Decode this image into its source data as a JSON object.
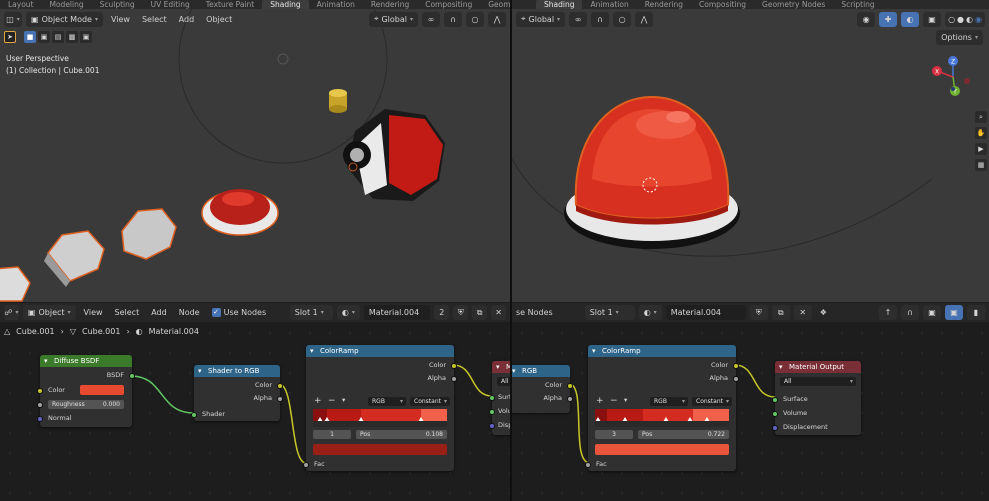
{
  "colors": {
    "accent": "#4772b3",
    "selection_outline": "#e06020",
    "diffuse_color": "#e84a30",
    "ramp_dark": "#8a1010",
    "ramp_red": "#d42c20",
    "ramp_light": "#f0604a",
    "left_ramp_output": "#9a1f17",
    "right_ramp_output": "#e8553b"
  },
  "left": {
    "tabs": [
      "Layout",
      "Modeling",
      "Sculpting",
      "UV Editing",
      "Texture Paint",
      "Shading",
      "Animation",
      "Rendering",
      "Compositing",
      "Geometry Nod"
    ],
    "active_tab": "Shading",
    "viewport": {
      "mode": "Object Mode",
      "menus": [
        "View",
        "Select",
        "Add",
        "Object"
      ],
      "transform_orientation": "Global",
      "perspective_label": "User Perspective",
      "collection_label": "(1) Collection | Cube.001"
    },
    "node_editor": {
      "type": "Object",
      "menus": [
        "View",
        "Select",
        "Add",
        "Node"
      ],
      "use_nodes_label": "Use Nodes",
      "slot": "Slot 1",
      "material": "Material.004",
      "user_count": "2",
      "breadcrumb": [
        "Cube.001",
        "Cube.001",
        "Material.004"
      ],
      "diffuse_node": {
        "title": "Diffuse BSDF",
        "output": "BSDF",
        "color_label": "Color",
        "roughness_label": "Roughness",
        "roughness_value": "0.000",
        "normal_label": "Normal"
      },
      "shader_rgb_node": {
        "title": "Shader to RGB",
        "color_label": "Color",
        "alpha_label": "Alpha",
        "shader_label": "Shader"
      },
      "ramp_node": {
        "title": "ColorRamp",
        "color_label": "Color",
        "alpha_label": "Alpha",
        "mode": "RGB",
        "interpolation": "Constant",
        "stop_index": "1",
        "pos_label": "Pos",
        "pos_value": "0.108",
        "fac_label": "Fac"
      },
      "output_node_partial": {
        "title": "M",
        "target": "All",
        "sockets": [
          "Surf",
          "Volu",
          "Disp"
        ]
      }
    }
  },
  "right": {
    "tabs": [
      "Shading",
      "Animation",
      "Rendering",
      "Compositing",
      "Geometry Nodes",
      "Scripting"
    ],
    "viewport": {
      "transform_orientation": "Global",
      "options_label": "Options",
      "gizmo_axes": [
        "X",
        "Y",
        "Z"
      ]
    },
    "node_editor": {
      "use_nodes_partial": "se Nodes",
      "slot": "Slot 1",
      "material": "Material.004",
      "shader_rgb_partial": {
        "title": "RGB",
        "color_label": "Color",
        "alpha_label": "Alpha"
      },
      "ramp_node": {
        "title": "ColorRamp",
        "color_label": "Color",
        "alpha_label": "Alpha",
        "mode": "RGB",
        "interpolation": "Constant",
        "stop_index": "3",
        "pos_label": "Pos",
        "pos_value": "0.722",
        "fac_label": "Fac"
      },
      "output_node": {
        "title": "Material Output",
        "target": "All",
        "surface_label": "Surface",
        "volume_label": "Volume",
        "displacement_label": "Displacement"
      }
    }
  }
}
